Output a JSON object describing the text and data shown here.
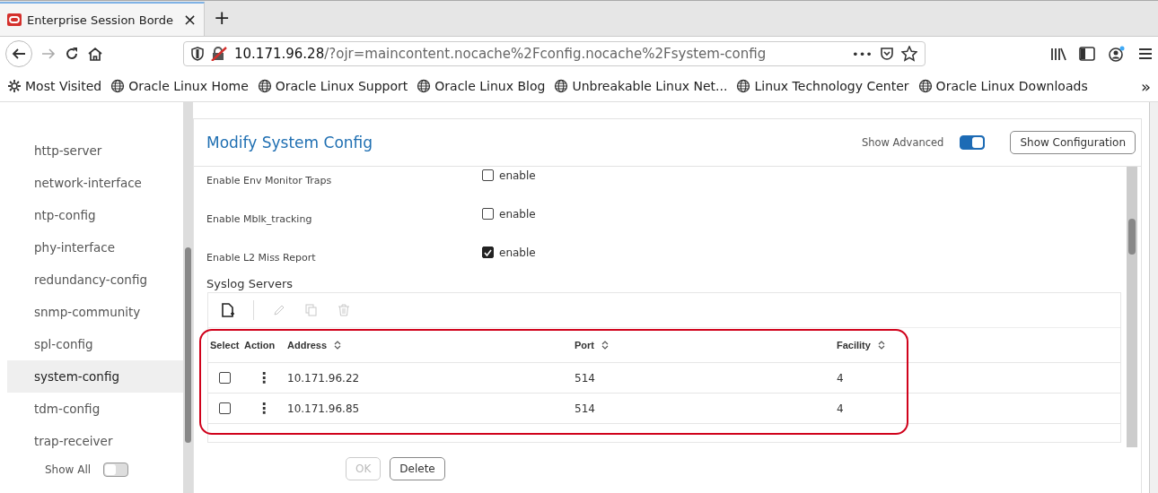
{
  "browser": {
    "tab": {
      "title": "Enterprise Session Borde",
      "close": "×"
    },
    "new_tab": "+",
    "address": {
      "host": "10.171.96.28",
      "path": "/?ojr=maincontent.nocache%2Fconfig.nocache%2Fsystem-config",
      "more": "•••"
    },
    "bookmarks": [
      {
        "kind": "folder",
        "label": "Most Visited"
      },
      {
        "kind": "site",
        "label": "Oracle Linux Home"
      },
      {
        "kind": "site",
        "label": "Oracle Linux Support"
      },
      {
        "kind": "site",
        "label": "Oracle Linux Blog"
      },
      {
        "kind": "site",
        "label": "Unbreakable Linux Net..."
      },
      {
        "kind": "site",
        "label": "Linux Technology Center"
      },
      {
        "kind": "site",
        "label": "Oracle Linux Downloads"
      }
    ],
    "bookmarks_overflow": "»"
  },
  "sidebar": {
    "items": [
      {
        "label": "http-server",
        "selected": false
      },
      {
        "label": "network-interface",
        "selected": false
      },
      {
        "label": "ntp-config",
        "selected": false
      },
      {
        "label": "phy-interface",
        "selected": false
      },
      {
        "label": "redundancy-config",
        "selected": false
      },
      {
        "label": "snmp-community",
        "selected": false
      },
      {
        "label": "spl-config",
        "selected": false
      },
      {
        "label": "system-config",
        "selected": true
      },
      {
        "label": "tdm-config",
        "selected": false
      },
      {
        "label": "trap-receiver",
        "selected": false
      }
    ],
    "show_all": {
      "label": "Show All",
      "on": false
    }
  },
  "panel": {
    "title": "Modify System Config",
    "show_advanced": {
      "label": "Show Advanced",
      "on": true
    },
    "show_configuration": "Show Configuration",
    "fields": [
      {
        "label": "Enable Env Monitor Traps",
        "option": "enable",
        "checked": false
      },
      {
        "label": "Enable Mblk_tracking",
        "option": "enable",
        "checked": false
      },
      {
        "label": "Enable L2 Miss Report",
        "option": "enable",
        "checked": true
      }
    ],
    "syslog": {
      "title": "Syslog Servers",
      "tools": [
        {
          "kind": "new",
          "disabled": false
        },
        {
          "kind": "edit",
          "disabled": true
        },
        {
          "kind": "copy",
          "disabled": true
        },
        {
          "kind": "delete",
          "disabled": true
        }
      ],
      "columns": [
        {
          "label": "Select",
          "sortable": false
        },
        {
          "label": "Action",
          "sortable": false
        },
        {
          "label": "Address",
          "sortable": true
        },
        {
          "label": "Port",
          "sortable": true
        },
        {
          "label": "Facility",
          "sortable": true
        }
      ],
      "rows": [
        {
          "selected": false,
          "action": "⋮",
          "address": "10.171.96.22",
          "port": "514",
          "facility": "4"
        },
        {
          "selected": false,
          "action": "⋮",
          "address": "10.171.96.85",
          "port": "514",
          "facility": "4"
        }
      ]
    },
    "buttons": [
      {
        "label": "OK",
        "disabled": true
      },
      {
        "label": "Delete",
        "disabled": false
      }
    ]
  }
}
